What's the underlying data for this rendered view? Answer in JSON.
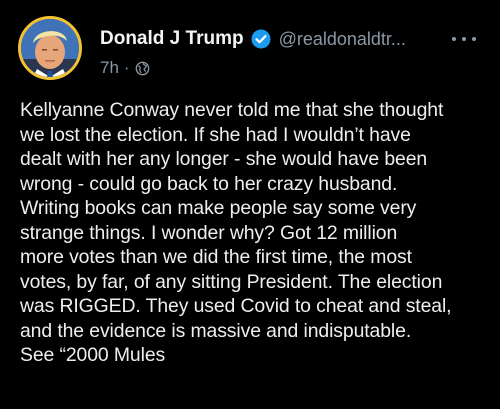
{
  "post": {
    "author": {
      "display_name": "Donald J Trump",
      "handle": "@realdonaldtr...",
      "verified": true,
      "avatar_icon": "profile-avatar"
    },
    "timestamp": "7h",
    "separator": "·",
    "visibility_icon": "globe-icon",
    "more_icon": "more-options-icon",
    "text": "Kellyanne Conway never told me that she thought\nwe lost the election. If she had I wouldn’t have\ndealt with her any longer - she would have been\nwrong - could go back to her crazy husband.\nWriting books can make people say some very\nstrange things. I wonder why? Got 12 million\nmore votes than we did the first time, the most\nvotes, by far, of any sitting President. The election\nwas RIGGED. They used Covid to cheat and steal,\nand the evidence is massive and indisputable.\nSee “2000 Mules"
  },
  "colors": {
    "background": "#000000",
    "text": "#eceef0",
    "muted": "#8b98a5",
    "verified_blue": "#1d9bf0",
    "avatar_ring": "#f2c230"
  }
}
